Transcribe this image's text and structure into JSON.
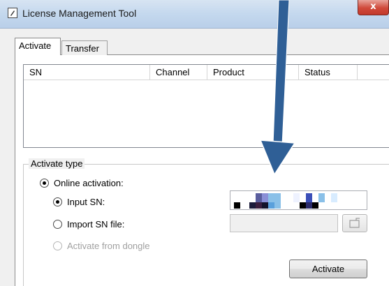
{
  "window": {
    "title": "License Management Tool",
    "close_glyph": "x"
  },
  "tabs": [
    {
      "label": "Activate",
      "selected": true
    },
    {
      "label": "Transfer",
      "selected": false
    }
  ],
  "list": {
    "columns": [
      "SN",
      "Channel",
      "Product",
      "Status"
    ],
    "rows": []
  },
  "activate_type": {
    "label": "Activate type",
    "online": {
      "label": "Online activation:",
      "selected": true
    },
    "input_sn": {
      "label": "Input SN:",
      "selected": true
    },
    "import_sn_file": {
      "label": "Import SN file:",
      "selected": false
    },
    "from_dongle": {
      "label": "Activate from dongle",
      "selected": false,
      "disabled": true
    }
  },
  "actions": {
    "activate_label": "Activate"
  },
  "icons": {
    "app": "license-app-icon",
    "browse": "open-folder-icon"
  },
  "colors": {
    "arrow": "#2f5f96",
    "close_button": "#c9473a"
  }
}
